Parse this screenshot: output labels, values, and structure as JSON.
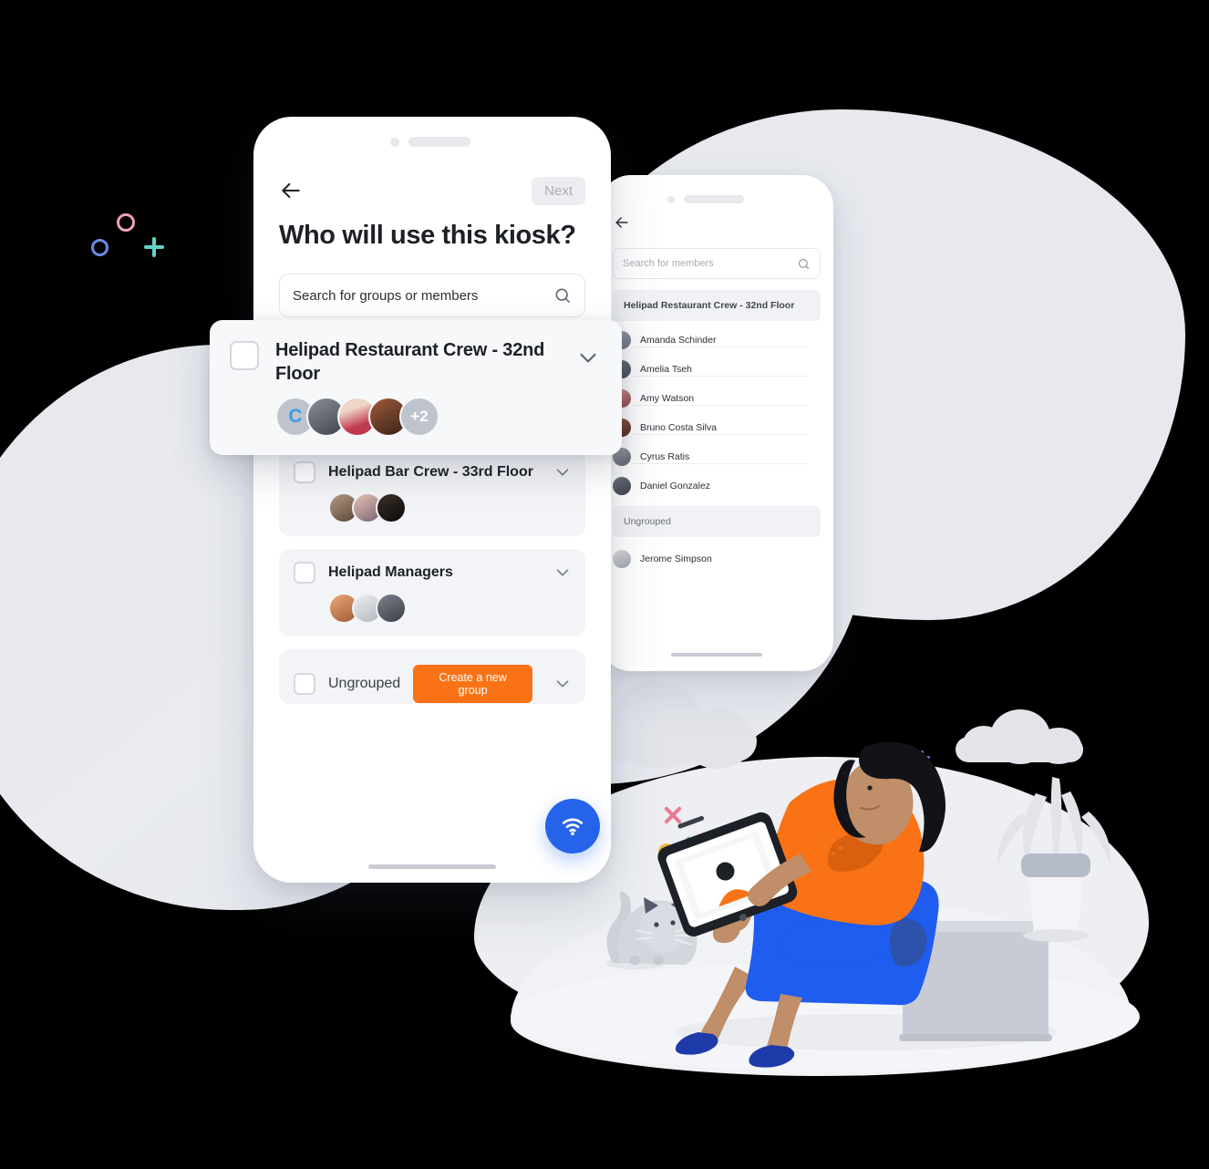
{
  "front_phone": {
    "back_icon": "arrow-left-icon",
    "next_label": "Next",
    "title": "Who will use this kiosk?",
    "search": {
      "placeholder": "Search for groups or members",
      "value": "Search for groups or members",
      "icon": "search-icon"
    },
    "fab_icon": "wifi-icon",
    "fab_color": "#2563EB",
    "groups": [
      {
        "name": "Helipad Restaurant Crew - 32nd Floor",
        "checked": false,
        "avatar_count": 5,
        "overflow_label": "+2",
        "initial_label": "C",
        "chevron": "chevron-down-icon"
      },
      {
        "name": "Helipad Bar Crew - 33rd Floor",
        "checked": false,
        "avatar_count": 3,
        "chevron": "chevron-down-icon"
      },
      {
        "name": "Helipad Managers",
        "checked": false,
        "avatar_count": 3,
        "chevron": "chevron-down-icon"
      },
      {
        "name": "Ungrouped",
        "checked": false,
        "avatar_count": 0,
        "action_label": "Create a new group",
        "action_color": "#F97316",
        "chevron": "chevron-down-icon"
      }
    ]
  },
  "overlay_card": {
    "title": "Helipad Restaurant Crew - 32nd Floor",
    "checked": false,
    "chevron": "chevron-down-icon",
    "initial_label": "C",
    "overflow_label": "+2"
  },
  "back_phone": {
    "back_icon": "arrow-left-icon",
    "search": {
      "placeholder": "Search for members",
      "value": "",
      "icon": "search-icon"
    },
    "sections": [
      {
        "label": "Helipad Restaurant Crew - 32nd Floor",
        "members": [
          "Amanda Schinder",
          "Amelia Tseh",
          "Amy Watson",
          "Bruno Costa Silva",
          "Cyrus Ratis",
          "Daniel Gonzalez"
        ]
      },
      {
        "label": "Ungrouped",
        "members": [
          "Jerome Simpson"
        ]
      }
    ]
  },
  "decorations": {
    "colors": {
      "pink": "#F0A0B4",
      "blue": "#6B8CE8",
      "teal": "#63D3C6",
      "orange": "#F5B93F",
      "purple": "#7C6BE8",
      "blue_ring": "#5B7CE8"
    }
  },
  "illustration": {
    "description": "woman-with-tablet-sitting-on-cube",
    "shirt_color": "#F97316",
    "skirt_color": "#1F5CF0",
    "shoe_color": "#1F3BAA",
    "cube_color": "#C8CBD3",
    "cat": "grey-cat",
    "plant": "potted-plant",
    "cloud": "cloud-shape"
  }
}
